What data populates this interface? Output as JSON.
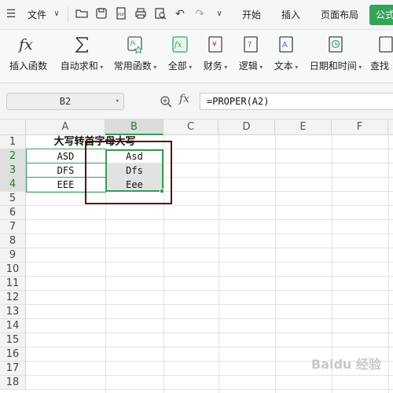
{
  "menubar": {
    "file_label": "文件",
    "tabs": [
      "开始",
      "插入",
      "页面布局",
      "公式"
    ]
  },
  "ribbon": {
    "buttons": [
      {
        "label": "插入函数",
        "icon": "fx-icon"
      },
      {
        "label": "自动求和",
        "icon": "sigma-icon"
      },
      {
        "label": "常用函数",
        "icon": "star-function-icon"
      },
      {
        "label": "全部",
        "icon": "fx-box-icon"
      },
      {
        "label": "财务",
        "icon": "yen-book-icon"
      },
      {
        "label": "逻辑",
        "icon": "question-book-icon"
      },
      {
        "label": "文本",
        "icon": "text-book-icon"
      },
      {
        "label": "日期和时间",
        "icon": "clock-book-icon"
      },
      {
        "label": "查找"
      }
    ]
  },
  "formula_bar": {
    "name_box": "B2",
    "fx_label": "fx",
    "formula": "=PROPER(A2)"
  },
  "sheet": {
    "columns": [
      "A",
      "B",
      "C",
      "D",
      "E",
      "F"
    ],
    "rows": [
      "1",
      "2",
      "3",
      "4",
      "5",
      "6",
      "7",
      "8",
      "9",
      "10",
      "11",
      "12",
      "13",
      "14",
      "15",
      "16",
      "17",
      "18"
    ],
    "title": "大写转首字母大写",
    "col_a": [
      "ASD",
      "DFS",
      "EEE"
    ],
    "col_b": [
      "Asd",
      "Dfs",
      "Eee"
    ]
  },
  "colors": {
    "accent": "#35a35a",
    "selection": "#3a9b57",
    "annotation_box": "#5a1010"
  },
  "watermark": "Baidu 经验"
}
